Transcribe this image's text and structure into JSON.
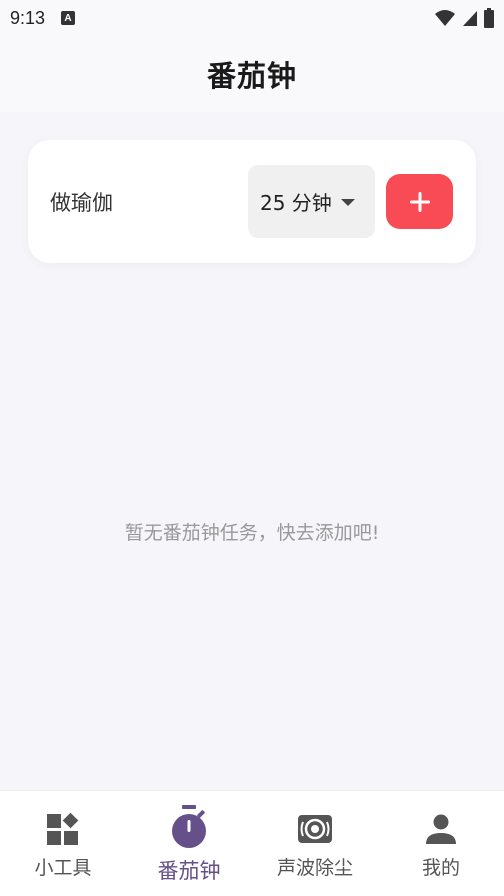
{
  "status_bar": {
    "time": "9:13",
    "notification_icon": "a-notification-icon",
    "wifi_icon": "wifi-icon",
    "signal_icon": "signal-icon",
    "battery_icon": "battery-icon"
  },
  "header": {
    "title": "番茄钟"
  },
  "task_form": {
    "task_value": "做瑜伽",
    "duration_value": "25 分钟",
    "add_icon": "plus-icon"
  },
  "main": {
    "empty_message": "暂无番茄钟任务，快去添加吧!"
  },
  "bottom_nav": {
    "items": [
      {
        "label": "小工具",
        "icon": "widgets-icon",
        "active": false
      },
      {
        "label": "番茄钟",
        "icon": "timer-icon",
        "active": true
      },
      {
        "label": "声波除尘",
        "icon": "speaker-icon",
        "active": false
      },
      {
        "label": "我的",
        "icon": "person-icon",
        "active": false
      }
    ]
  },
  "colors": {
    "accent": "#f84b55",
    "active_nav": "#66508a",
    "background": "#f6f6fa"
  }
}
